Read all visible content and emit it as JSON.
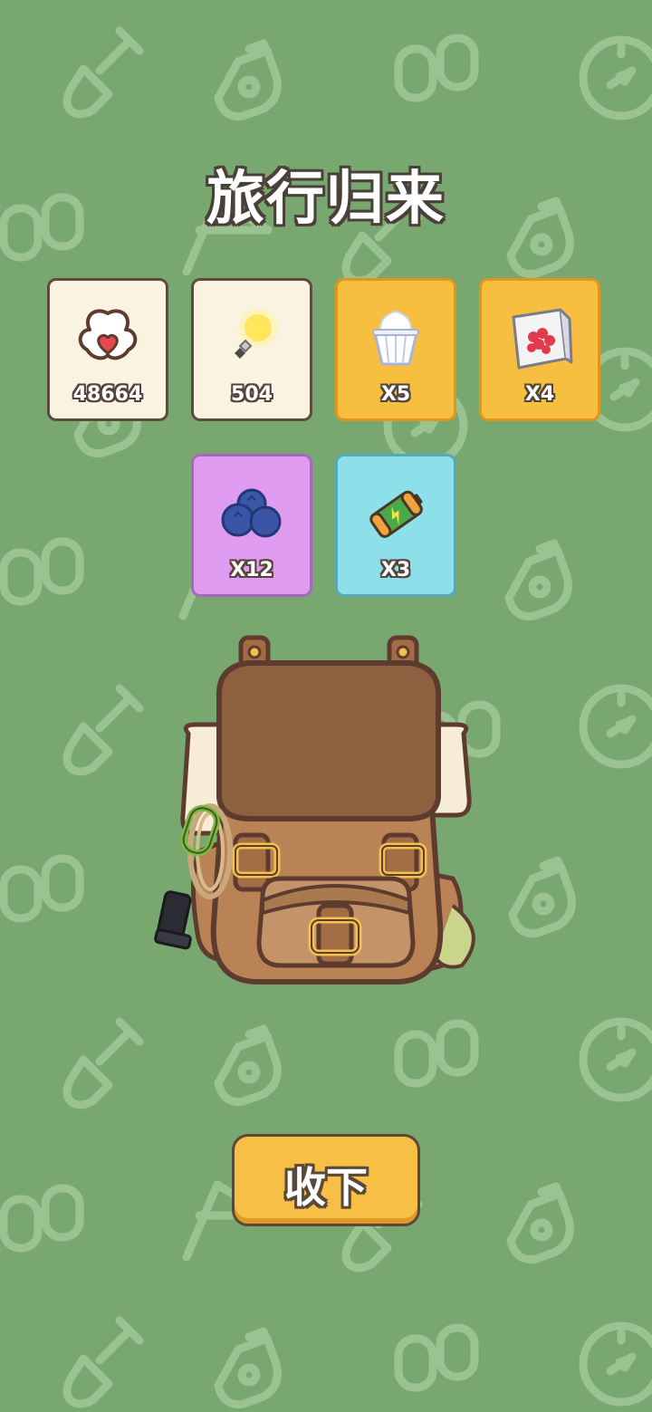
{
  "screen": {
    "title": "旅行归来",
    "background_color": "#78a870"
  },
  "rewards": [
    {
      "icon": "clover-heart-icon",
      "label": "48664",
      "style": "cream"
    },
    {
      "icon": "lightbulb-icon",
      "label": "504",
      "style": "cream"
    },
    {
      "icon": "frozen-yogurt-icon",
      "label": "X5",
      "style": "orange"
    },
    {
      "icon": "raspberry-pack-icon",
      "label": "X4",
      "style": "orange"
    },
    {
      "icon": "blueberry-icon",
      "label": "X12",
      "style": "purple"
    },
    {
      "icon": "battery-icon",
      "label": "X3",
      "style": "cyan"
    }
  ],
  "actions": {
    "collect_label": "收下"
  }
}
